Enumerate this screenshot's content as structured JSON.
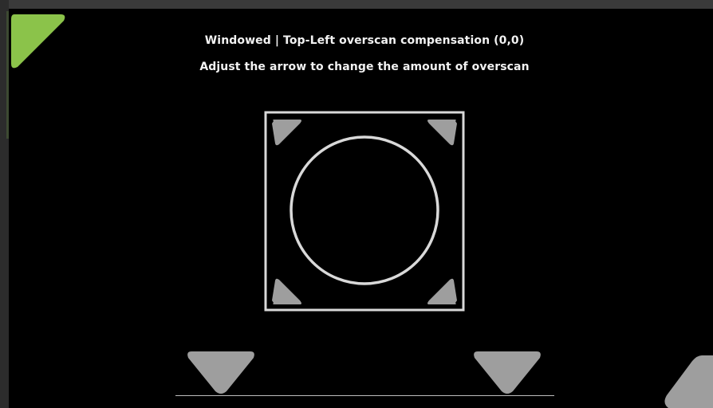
{
  "window": {
    "mode": "Windowed"
  },
  "overscan": {
    "title": "Windowed | Top-Left overscan compensation (0,0)",
    "instructions": "Adjust the arrow to change the amount of overscan",
    "corner": "Top-Left",
    "value": [
      0,
      0
    ]
  },
  "colors": {
    "background": "#000000",
    "active_arrow": "#8bc34a",
    "inactive_arrow": "#9e9e9e",
    "frame": "#d9d9d9",
    "text": "#f2f2f2"
  },
  "icons": {
    "top_left_arrow": "corner-arrow-icon",
    "calibration_target": "calibration-frame-icon",
    "circle": "calibration-circle-icon",
    "down_arrows": "down-arrow-icon",
    "bottom_right_arrow": "corner-arrow-icon"
  }
}
